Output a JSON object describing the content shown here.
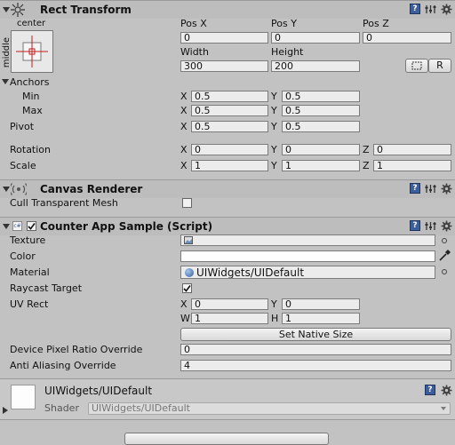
{
  "rect_transform": {
    "title": "Rect Transform",
    "anchor_preset_top": "center",
    "anchor_preset_side": "middle",
    "pos_x_label": "Pos X",
    "pos_y_label": "Pos Y",
    "pos_z_label": "Pos Z",
    "pos_x": "0",
    "pos_y": "0",
    "pos_z": "0",
    "width_label": "Width",
    "height_label": "Height",
    "width": "300",
    "height": "200",
    "raw_edit_label": "R",
    "anchors_label": "Anchors",
    "min_label": "Min",
    "max_label": "Max",
    "anchors_min_x": "0.5",
    "anchors_min_y": "0.5",
    "anchors_max_x": "0.5",
    "anchors_max_y": "0.5",
    "pivot_label": "Pivot",
    "pivot_x": "0.5",
    "pivot_y": "0.5",
    "rotation_label": "Rotation",
    "rotation_x": "0",
    "rotation_y": "0",
    "rotation_z": "0",
    "scale_label": "Scale",
    "scale_x": "1",
    "scale_y": "1",
    "scale_z": "1",
    "x_letter": "X",
    "y_letter": "Y",
    "z_letter": "Z"
  },
  "canvas_renderer": {
    "title": "Canvas Renderer",
    "cull_label": "Cull Transparent Mesh",
    "cull_checked": false
  },
  "script": {
    "title": "Counter App Sample (Script)",
    "enabled": true,
    "texture_label": "Texture",
    "color_label": "Color",
    "color_value": "#ffffff",
    "material_label": "Material",
    "material_value": "UIWidgets/UIDefault",
    "raycast_label": "Raycast Target",
    "raycast_checked": true,
    "uvrect_label": "UV Rect",
    "uv_x": "0",
    "uv_y": "0",
    "uv_w": "1",
    "uv_h": "1",
    "w_letter": "W",
    "h_letter": "H",
    "set_native_size": "Set Native Size",
    "dpr_label": "Device Pixel Ratio Override",
    "dpr_value": "0",
    "aa_label": "Anti Aliasing Override",
    "aa_value": "4"
  },
  "material": {
    "name": "UIWidgets/UIDefault",
    "shader_label": "Shader",
    "shader_value": "UIWidgets/UIDefault"
  }
}
